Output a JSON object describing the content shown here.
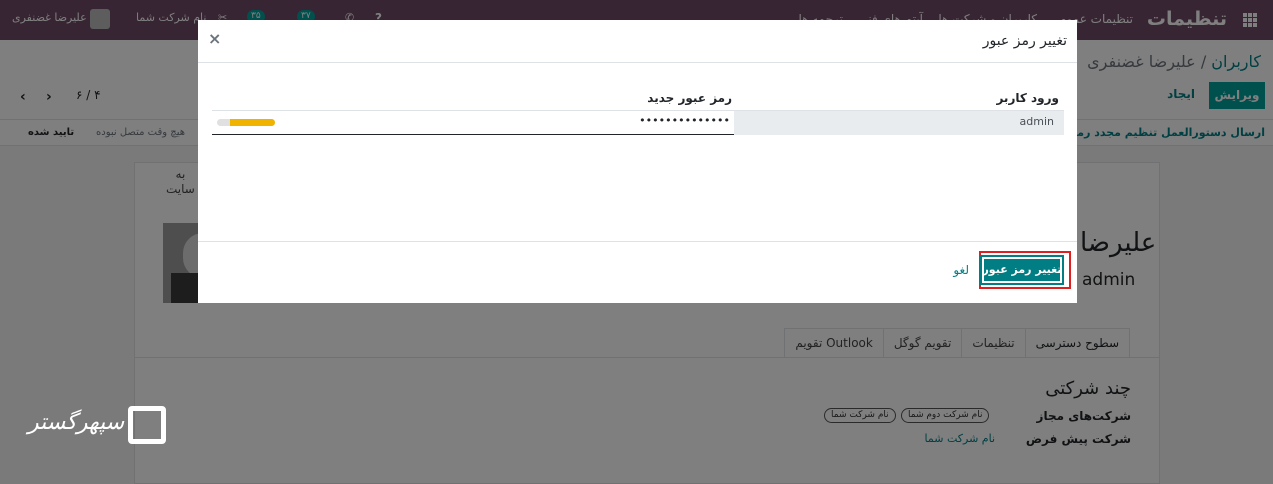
{
  "navbar": {
    "app_title": "تنظیمات",
    "menu_items": [
      "تنظیمات عمومی",
      "کاربران و شرکت ها",
      "آیتم های فنی",
      "ترجمه ها"
    ],
    "company": "نام شرکت شما",
    "user": "علیرضا غضنفری",
    "activity_count": "۳۷",
    "message_count": "۳۵"
  },
  "breadcrumb": {
    "parent": "کاربران",
    "separator": "/",
    "current": "علیرضا غضنفری"
  },
  "toolbar": {
    "edit": "ویرایش",
    "create": "ایجاد",
    "pager": "۶ / ۴"
  },
  "statusbar": {
    "action": "ارسال دستورالعمل تنظیم مجدد رمز عبور",
    "never_connected": "هیچ وقت متصل نبوده",
    "confirmed": "تایید شده"
  },
  "form": {
    "smart_button": "به\nسایت",
    "name": "علیرضا",
    "login": "admin",
    "tabs": [
      "سطوح دسترسی",
      "تنظیمات",
      "تقویم گوگل",
      "تقویم Outlook"
    ],
    "group_title": "چند شرکتی",
    "allowed_companies_label": "شرکت‌های مجاز",
    "allowed_companies": [
      "نام شرکت دوم شما",
      "نام شرکت شما"
    ],
    "default_company_label": "شرکت پیش فرض",
    "default_company": "نام شرکت شما"
  },
  "watermark": "سپهرگستر",
  "modal": {
    "title": "تغییر رمز عبور",
    "close": "×",
    "col_login": "ورود کاربر",
    "col_new_password": "رمز عبور جدید",
    "login_value": "admin",
    "password_value": "••••••••••••••",
    "password_strength": 0.78,
    "strength_color": "#f0b400",
    "submit": "تغییر رمز عبور",
    "cancel": "لغو",
    "highlight_color": "#e02020"
  }
}
